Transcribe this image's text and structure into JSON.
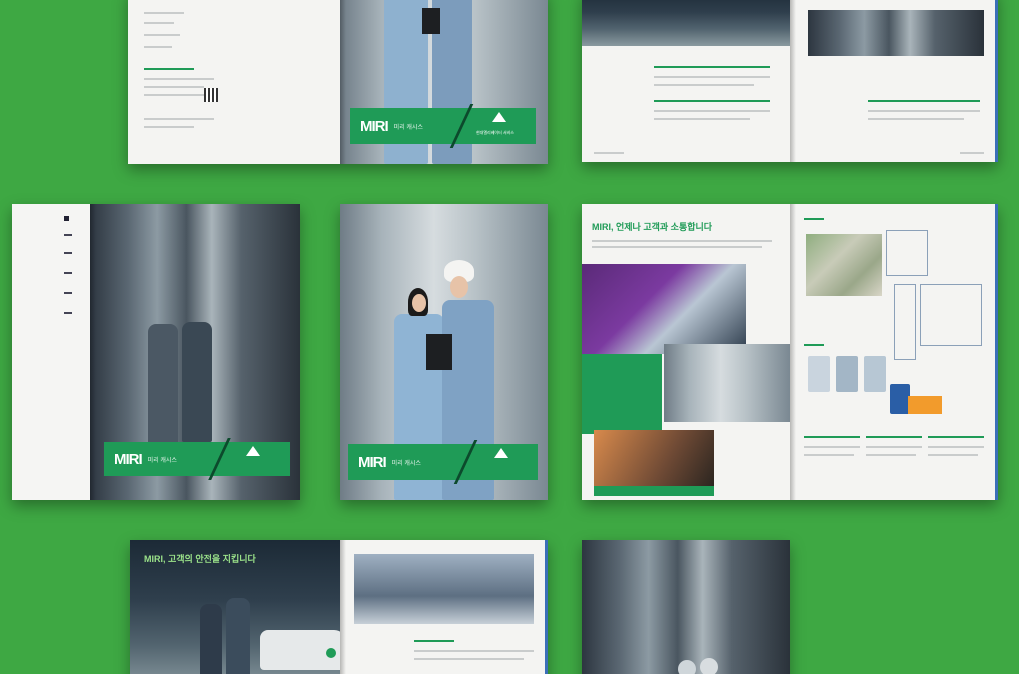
{
  "image": {
    "background_color": "#3ea843",
    "accent_green": "#1f9b57",
    "logo_text": "MIRI",
    "logo_subtitle": "미리 캐시스",
    "cover_badge_text": "현대엘리베이터 서비스",
    "spread_heading_1": "MIRI, 언제나 고객과 소통합니다",
    "spread_heading_2": "MIRI, 고객의 안전을 지킵니다"
  }
}
